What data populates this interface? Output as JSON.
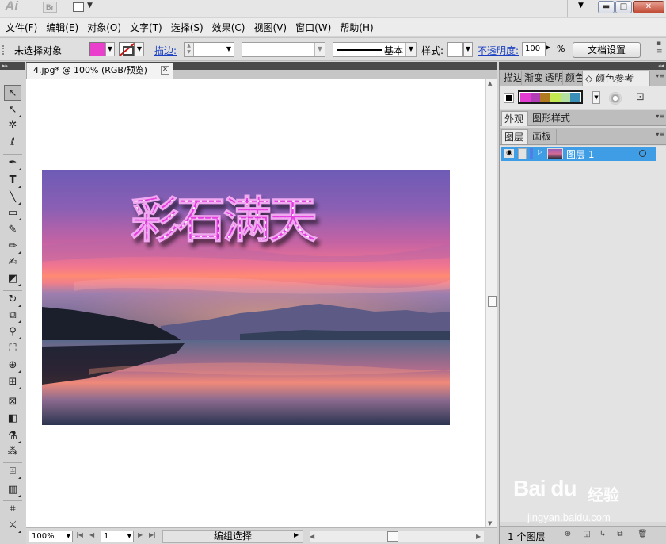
{
  "app": {
    "logo_text": "Ai",
    "bridge_badge": "Br"
  },
  "menu": [
    "文件(F)",
    "编辑(E)",
    "对象(O)",
    "文字(T)",
    "选择(S)",
    "效果(C)",
    "视图(V)",
    "窗口(W)",
    "帮助(H)"
  ],
  "control_bar": {
    "selection_status": "未选择对象",
    "fill_color": "#ea3fcd",
    "stroke_label": "描边:",
    "brush_label": "基本",
    "style_label": "样式:",
    "opacity_label": "不透明度:",
    "opacity_value": "100",
    "opacity_unit": "%",
    "doc_setup_button": "文档设置"
  },
  "document": {
    "tab_title": "4.jpg* @ 100% (RGB/预览)",
    "artwork_title": "彩石满天"
  },
  "status_bar": {
    "zoom": "100%",
    "page": "1",
    "status_text": "编组选择"
  },
  "panels": {
    "top_tabs": [
      "描边",
      "渐变",
      "透明",
      "颜色",
      "颜色参考"
    ],
    "guide_colors": [
      "#e43cd3",
      "#b23eb5",
      "#b07b20",
      "#c4e850",
      "#b3e0a0",
      "#3a8fb8"
    ],
    "mid_tabs": [
      "外观",
      "图形样式"
    ],
    "layer_tabs": [
      "图层",
      "画板"
    ],
    "layer_name": "图层 1",
    "layers_count": "1 个图层"
  },
  "watermark": {
    "logo": "Bai du",
    "cn": "经验",
    "url": "jingyan.baidu.com"
  }
}
